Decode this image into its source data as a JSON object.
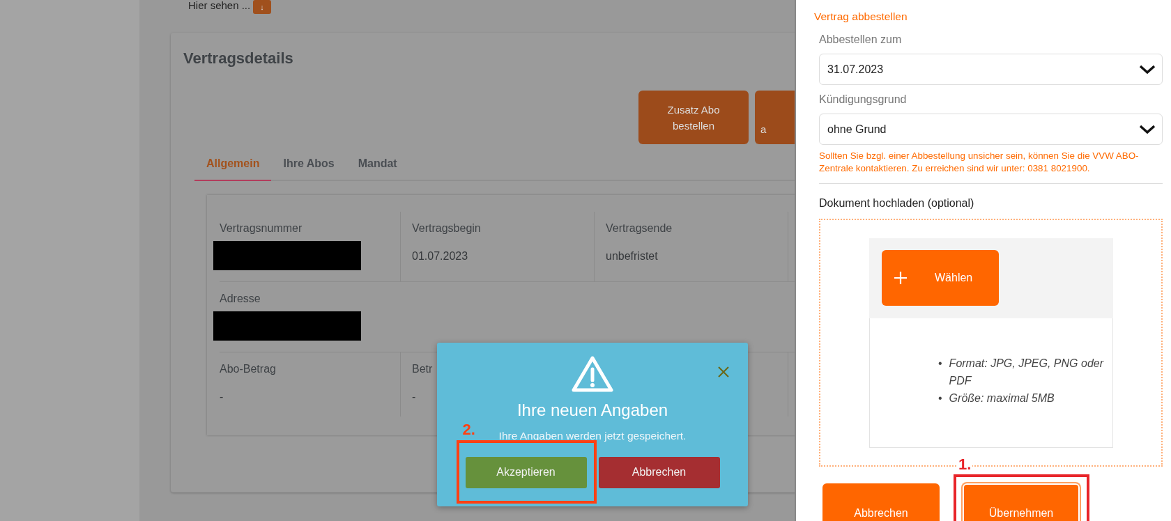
{
  "background": {
    "intro_text": "Hier sehen ...",
    "scroll_button": "↓"
  },
  "contract": {
    "title": "Vertragsdetails",
    "action_buttons": [
      "Zusatz Abo bestellen",
      "a"
    ],
    "tabs": [
      {
        "label": "Allgemein",
        "selected": true
      },
      {
        "label": "Ihre Abos",
        "selected": false
      },
      {
        "label": "Mandat",
        "selected": false
      }
    ],
    "rows": [
      [
        {
          "kind": "redacted",
          "label": "Vertragsnummer"
        },
        {
          "kind": "text",
          "label": "Vertragsbegin",
          "value": "01.07.2023"
        },
        {
          "kind": "text",
          "label": "Vertragsende",
          "value": "unbefristet"
        }
      ],
      [
        {
          "kind": "redacted",
          "label": "Adresse"
        }
      ],
      [
        {
          "kind": "text",
          "label": "Abo-Betrag",
          "value": "-"
        },
        {
          "kind": "text",
          "label": "Betr",
          "value": "-"
        }
      ]
    ]
  },
  "dialog": {
    "title": "Ihre neuen Angaben",
    "message": "Ihre Angaben werden jetzt gespeichert.",
    "buttons": [
      {
        "label": "Akzeptieren",
        "kind": "accept",
        "annotation": {
          "label": "2.",
          "color": "#ff4013"
        }
      },
      {
        "label": "Abbrechen",
        "kind": "cancel"
      }
    ]
  },
  "side_panel": {
    "title": "Vertrag abbestellen",
    "selects": [
      {
        "label": "Abbestellen zum",
        "value": "31.07.2023"
      },
      {
        "label": "Kündigungsgrund",
        "value": "ohne Grund"
      }
    ],
    "hint": "Sollten Sie bzgl. einer Abbestellung unsicher sein, können Sie die VVW ABO-Zentrale kontaktieren. Zu erreichen sind wir unter: 0381 8021900.",
    "upload": {
      "label": "Dokument hochladen (optional)",
      "button": "Wählen",
      "requirements": [
        {
          "bullet": "•",
          "text": "Format: JPG, JPEG, PNG oder PDF"
        },
        {
          "bullet": "•",
          "text": "Größe: maximal 5MB"
        }
      ]
    },
    "buttons": [
      {
        "label": "Abbrechen",
        "focused": false
      },
      {
        "label": "Übernehmen",
        "focused": true,
        "annotation": {
          "label": "1.",
          "color": "#e8252a"
        }
      }
    ]
  }
}
